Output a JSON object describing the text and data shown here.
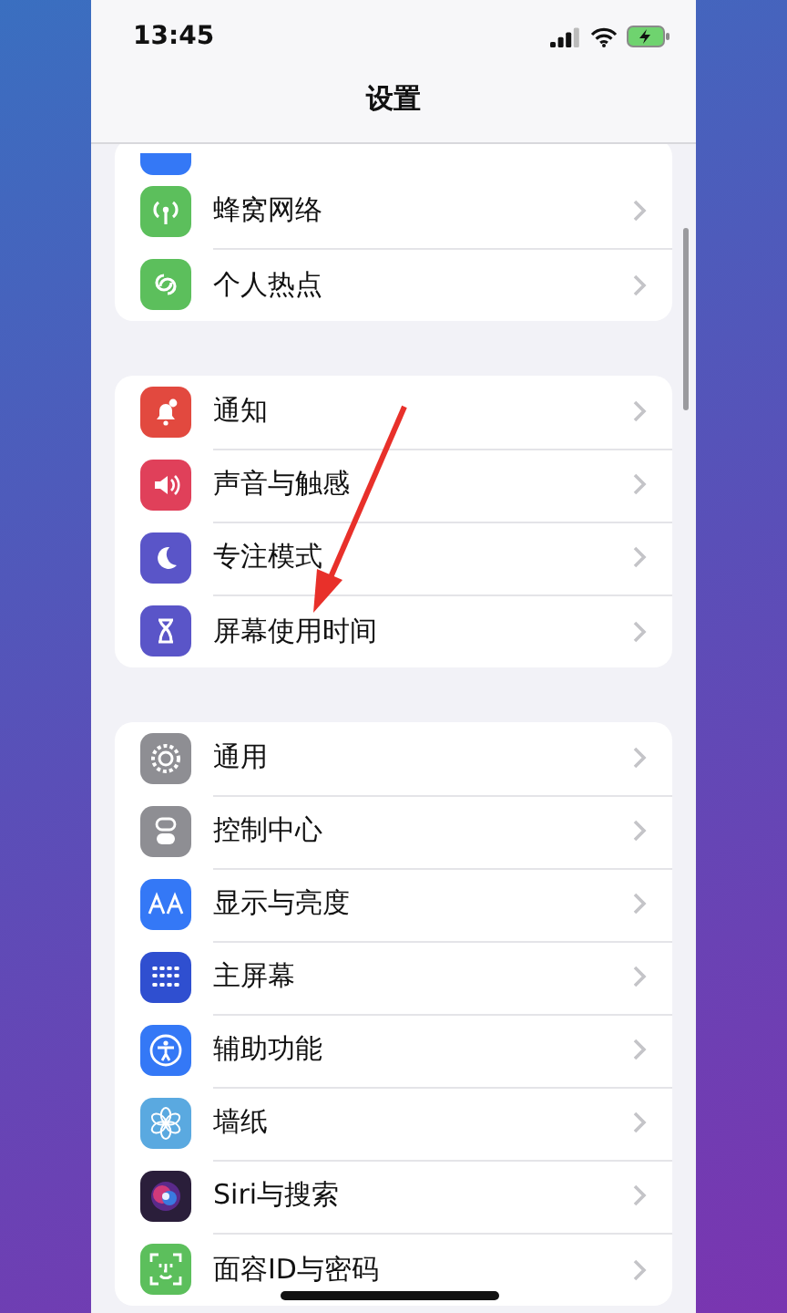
{
  "status_bar": {
    "time": "13:45"
  },
  "title": "设置",
  "groups": [
    {
      "items": [
        {
          "label": "蜂窝网络"
        },
        {
          "label": "个人热点"
        }
      ]
    },
    {
      "items": [
        {
          "label": "通知"
        },
        {
          "label": "声音与触感"
        },
        {
          "label": "专注模式"
        },
        {
          "label": "屏幕使用时间"
        }
      ]
    },
    {
      "items": [
        {
          "label": "通用"
        },
        {
          "label": "控制中心"
        },
        {
          "label": "显示与亮度"
        },
        {
          "label": "主屏幕"
        },
        {
          "label": "辅助功能"
        },
        {
          "label": "墙纸"
        },
        {
          "label": "Siri与搜索"
        },
        {
          "label": "面容ID与密码"
        }
      ]
    }
  ]
}
